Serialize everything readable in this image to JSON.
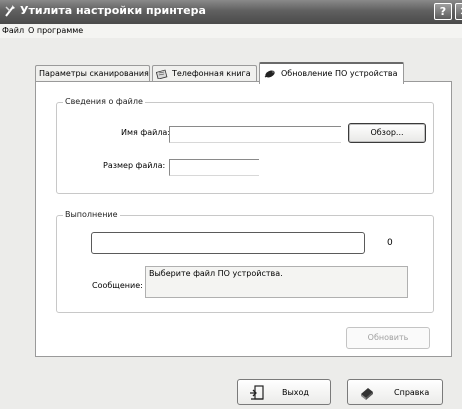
{
  "window": {
    "title": "Утилита настройки принтера",
    "help_button": "?",
    "close_button": "✕"
  },
  "menu": {
    "items": [
      "Файл",
      "О программе"
    ]
  },
  "tabs": [
    {
      "label": "Параметры сканирования",
      "icon": "none"
    },
    {
      "label": "Телефонная книга",
      "icon": "phone-book-icon"
    },
    {
      "label": "Обновление ПО устройства",
      "icon": "firmware-icon"
    }
  ],
  "file_info": {
    "legend": "Сведения о файле",
    "filename_label": "Имя файла:",
    "filename_value": "",
    "filesize_label": "Размер файла:",
    "filesize_value": "",
    "browse_button": "Обзор..."
  },
  "progress": {
    "legend": "Выполнение",
    "value_text": "0",
    "fraction": 0,
    "message_label": "Сообщение:",
    "message_text": "Выберите файл ПО устройства."
  },
  "update_button": "Обновить",
  "footer": {
    "exit_button": "Выход",
    "help_button": "Справка"
  }
}
